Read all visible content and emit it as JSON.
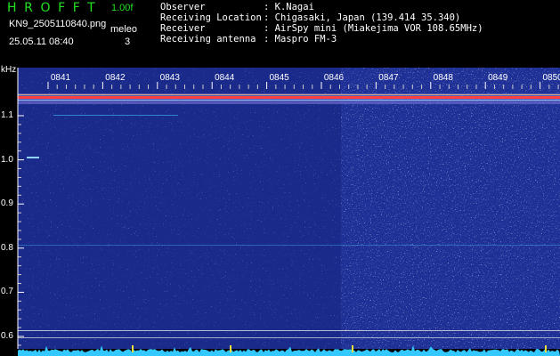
{
  "header": {
    "app_title": "HROFFT",
    "version": "1.00f",
    "filename": "KN9_2505110840.png",
    "datetime": "25.05.11 08:40",
    "meleo_label": "meleo",
    "meleo_value": "3"
  },
  "info": [
    {
      "label": "Observer",
      "value": ": K.Nagai"
    },
    {
      "label": "Receiving Location",
      "value": ": Chigasaki, Japan (139.414 35.340)"
    },
    {
      "label": "Receiver",
      "value": ": AirSpy mini (Miakejima VOR 108.65MHz)"
    },
    {
      "label": "Receiving antenna",
      "value": ": Maspro FM-3"
    }
  ],
  "axis": {
    "unit": "kHz",
    "y_ticks": [
      "1.1",
      "1.0",
      "0.9",
      "0.8",
      "0.7",
      "0.6"
    ],
    "time_ticks": [
      "0841",
      "0842",
      "0843",
      "0844",
      "0845",
      "0846",
      "0847",
      "0848",
      "0849",
      "0850"
    ]
  },
  "colors": {
    "background": "#000000",
    "waterfall": "#1a2a8a",
    "title_green": "#22e022",
    "carrier": "#ff4040",
    "noise_floor": "#33c8ff"
  }
}
